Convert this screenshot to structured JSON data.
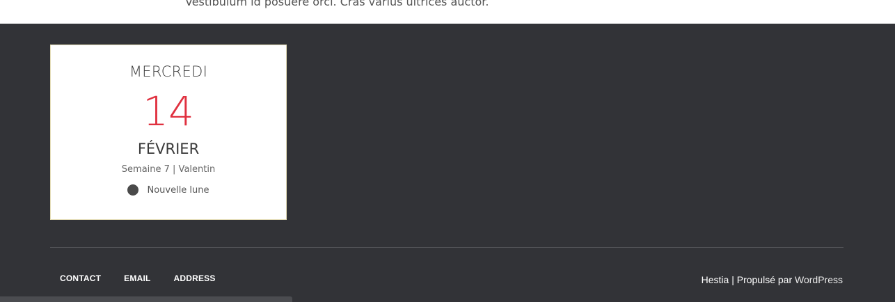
{
  "top": {
    "text": "Vestibulum id posuere orci. Cras varius ultrices auctor."
  },
  "calendar": {
    "weekday": "MERCREDI",
    "day": "14",
    "month": "FÉVRIER",
    "week_info": "Semaine 7 | Valentin",
    "moon_phase": "Nouvelle lune"
  },
  "footer": {
    "nav": [
      "CONTACT",
      "EMAIL",
      "ADDRESS"
    ],
    "credit_theme": "Hestia",
    "credit_separator": " | ",
    "credit_powered": "Propulsé par ",
    "credit_wp": "WordPress"
  },
  "colors": {
    "footer_bg": "#323337",
    "date_accent": "#e0303f"
  }
}
